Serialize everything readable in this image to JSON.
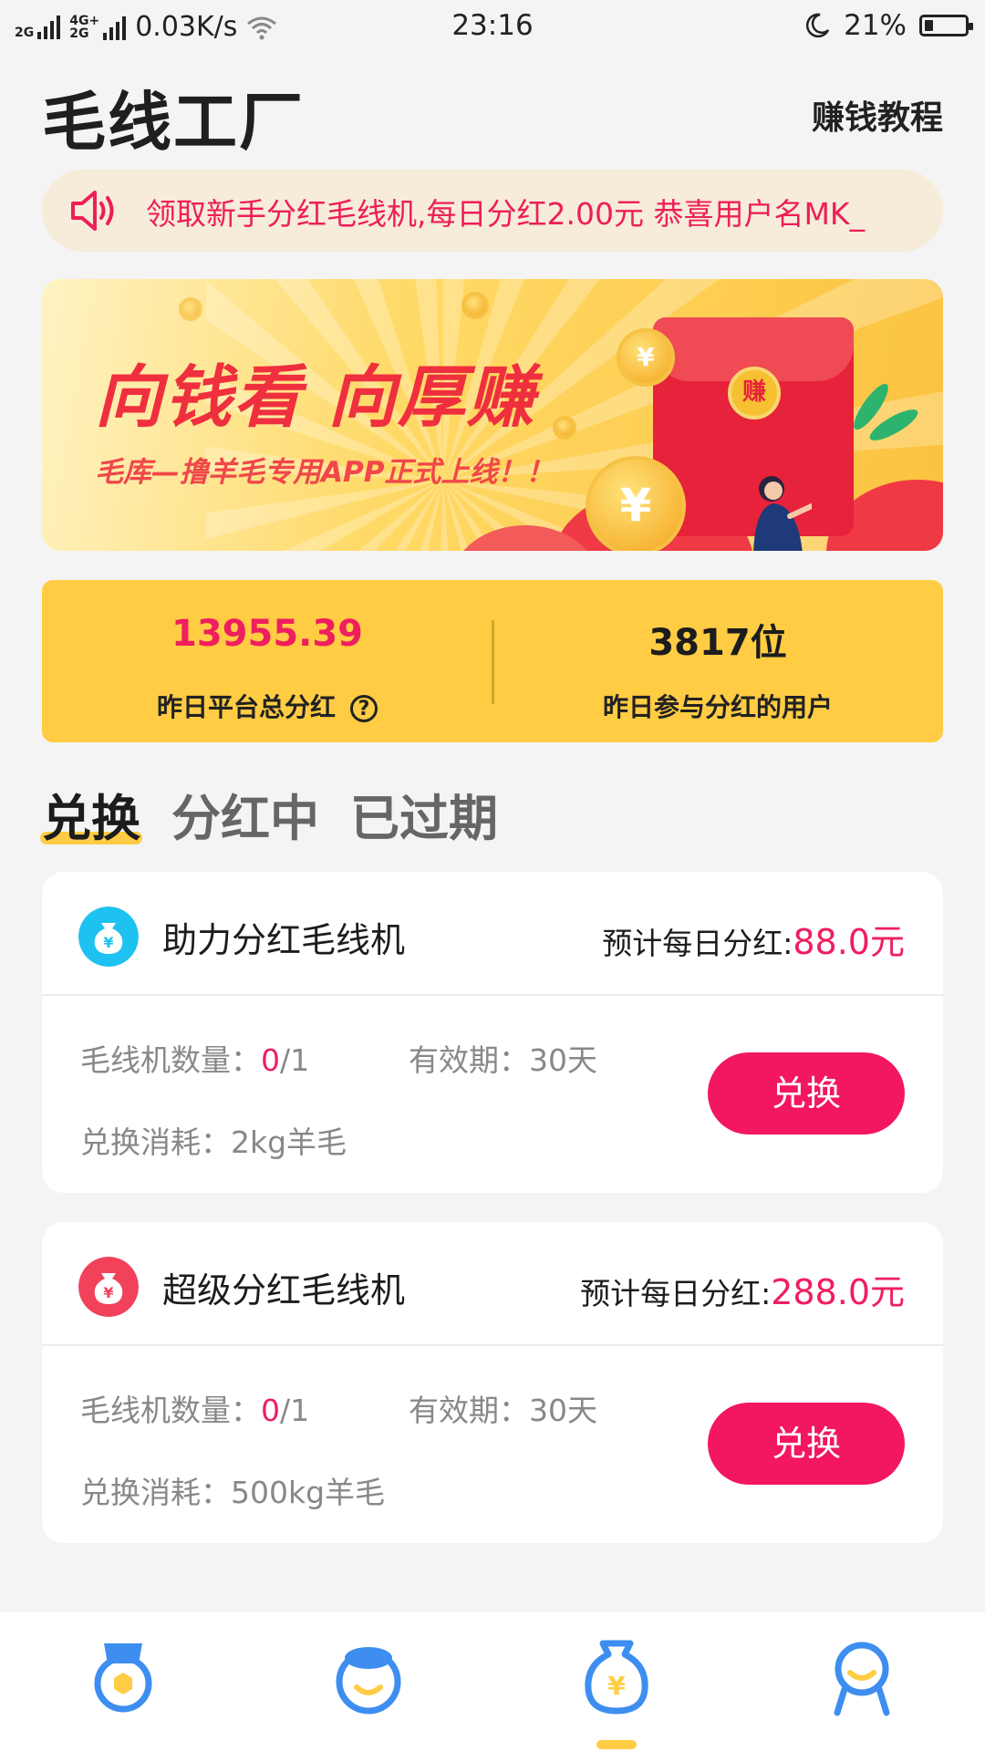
{
  "status_bar": {
    "sim1": "2G",
    "sim2_top": "4G+",
    "sim2_bottom": "2G",
    "speed": "0.03K/s",
    "time": "23:16",
    "battery": "21%",
    "battery_level": 0.21
  },
  "header": {
    "title": "毛线工厂",
    "tutorial_link": "赚钱教程"
  },
  "notice": {
    "text": "领取新手分红毛线机,每日分红2.00元  恭喜用户名MK_"
  },
  "banner": {
    "headline": "向钱看 向厚赚",
    "subline": "毛库—撸羊毛专用APP正式上线！！",
    "envelope_char": "赚",
    "coin_char": "¥"
  },
  "stats": {
    "total_dividend_value": "13955.39",
    "total_dividend_label": "昨日平台总分红",
    "help_icon": "?",
    "users_value": "3817位",
    "users_label": "昨日参与分红的用户"
  },
  "tabs": [
    {
      "label": "兑换",
      "active": true
    },
    {
      "label": "分红中",
      "active": false
    },
    {
      "label": "已过期",
      "active": false
    }
  ],
  "cards": [
    {
      "name": "助力分红毛线机",
      "daily_label": "预计每日分红:",
      "daily_amount": "88.0元",
      "count_label": "毛线机数量：",
      "count_owned": "0",
      "count_total": "/1",
      "validity": "有效期：30天",
      "cost": "兑换消耗：2kg羊毛",
      "button": "兑换",
      "icon_color": "#1ec2f0",
      "icon_char": "¥"
    },
    {
      "name": "超级分红毛线机",
      "daily_label": "预计每日分红:",
      "daily_amount": "288.0元",
      "count_label": "毛线机数量：",
      "count_owned": "0",
      "count_total": "/1",
      "validity": "有效期：30天",
      "cost": "兑换消耗：500kg羊毛",
      "button": "兑换",
      "icon_color": "#f2415a",
      "icon_char": "¥"
    }
  ],
  "bottom_nav": [
    {
      "icon": "medal-icon"
    },
    {
      "icon": "sheep-face-icon"
    },
    {
      "icon": "money-bag-icon",
      "active": true
    },
    {
      "icon": "user-profile-icon"
    }
  ],
  "colors": {
    "accent": "#ffcc44",
    "brand_red": "#ef1e5f",
    "nav_blue": "#3d8ef0"
  }
}
